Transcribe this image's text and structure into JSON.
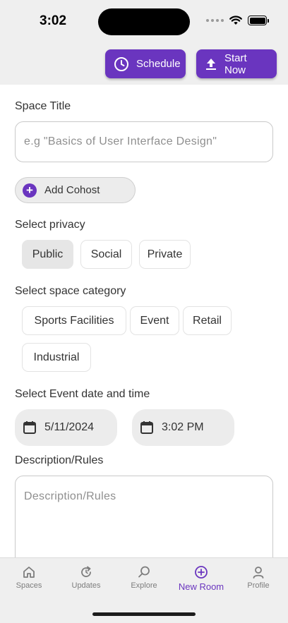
{
  "status_bar": {
    "time": "3:02"
  },
  "actions": {
    "schedule_label": "Schedule",
    "start_label": "Start Now"
  },
  "form": {
    "title_label": "Space Title",
    "title_placeholder": "e.g \"Basics of User Interface Design\"",
    "title_value": "",
    "cohost_label": "Add Cohost",
    "privacy_label": "Select privacy",
    "privacy_options": [
      "Public",
      "Social",
      "Private"
    ],
    "privacy_selected": "Public",
    "category_label": "Select space category",
    "category_options": [
      "Sports Facilities",
      "Event",
      "Retail",
      "Industrial"
    ],
    "datetime_label": "Select Event date and time",
    "date_value": "5/11/2024",
    "time_value": "3:02 PM",
    "description_label": "Description/Rules",
    "description_placeholder": "Description/Rules",
    "description_value": ""
  },
  "tabs": [
    {
      "label": "Spaces",
      "icon": "home-icon"
    },
    {
      "label": "Updates",
      "icon": "refresh-icon"
    },
    {
      "label": "Explore",
      "icon": "search-icon"
    },
    {
      "label": "New Room",
      "icon": "plus-circle-icon",
      "active": true
    },
    {
      "label": "Profile",
      "icon": "person-icon"
    }
  ],
  "colors": {
    "accent": "#6a35bf",
    "background": "#efefef"
  }
}
